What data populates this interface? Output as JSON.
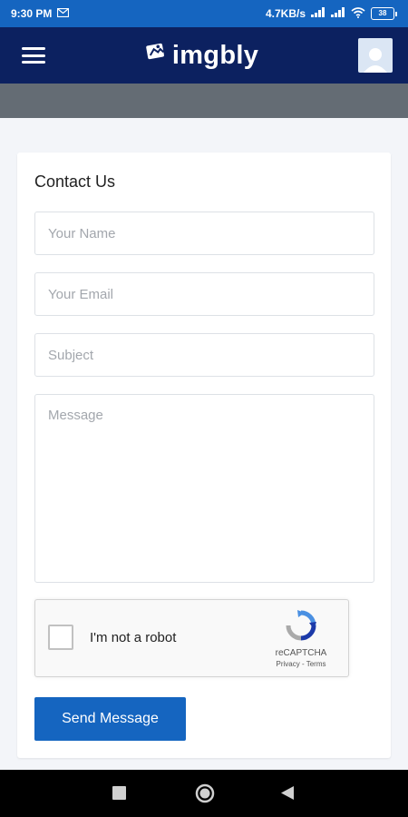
{
  "status_bar": {
    "time": "9:30 PM",
    "network_speed": "4.7KB/s",
    "battery": "38",
    "icons": [
      "gmail-icon",
      "signal-icon",
      "wifi-icon",
      "battery-icon"
    ]
  },
  "app_bar": {
    "logo_text": "imgbly",
    "icons": [
      "menu-icon",
      "logo-icon",
      "avatar-icon"
    ]
  },
  "contact_form": {
    "title": "Contact Us",
    "name_placeholder": "Your Name",
    "email_placeholder": "Your Email",
    "subject_placeholder": "Subject",
    "message_placeholder": "Message",
    "recaptcha": {
      "label": "I'm not a robot",
      "brand": "reCAPTCHA",
      "privacy": "Privacy",
      "separator": " - ",
      "terms": "Terms"
    },
    "submit_label": "Send Message"
  },
  "nav_bar": {
    "icons": [
      "recents-icon",
      "home-icon",
      "back-icon"
    ]
  },
  "colors": {
    "status_bar": "#1565c0",
    "app_bar": "#0c2160",
    "sub_bar": "#646c74",
    "button": "#1565c0",
    "background": "#f3f5f9"
  }
}
